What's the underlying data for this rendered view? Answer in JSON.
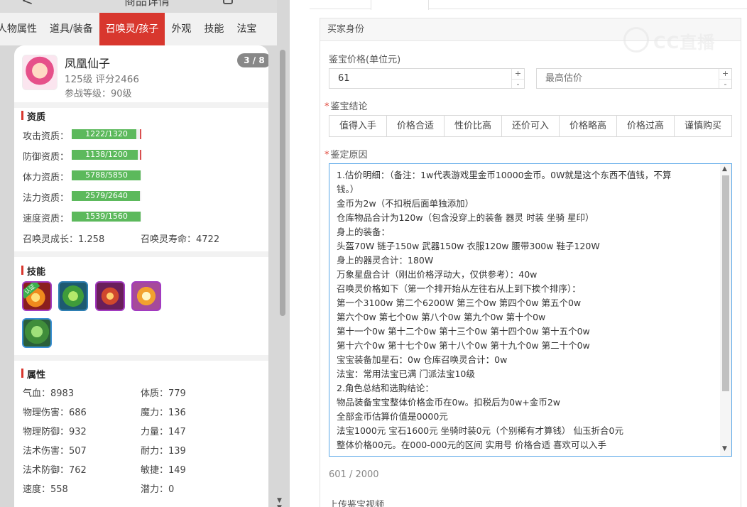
{
  "left": {
    "header": {
      "back_glyph": "<",
      "title": "商品详情"
    },
    "tabs": [
      "人物属性",
      "道具/装备",
      "召唤灵/孩子",
      "外观",
      "技能",
      "法宝"
    ],
    "active_tab_index": 2,
    "pet": {
      "name": "凤凰仙子",
      "meta": "125级 评分2466",
      "battle_level": "参战等级：90级",
      "page": "3 / 8"
    },
    "aptitude": {
      "title": "资质",
      "rows": [
        {
          "label": "攻击资质：",
          "value": "1222/1320",
          "fill": 0.926
        },
        {
          "label": "防御资质：",
          "value": "1138/1200",
          "fill": 0.948
        },
        {
          "label": "体力资质：",
          "value": "5788/5850",
          "fill": 0.989
        },
        {
          "label": "法力资质：",
          "value": "2579/2640",
          "fill": 0.977
        },
        {
          "label": "速度资质：",
          "value": "1539/1560",
          "fill": 0.987
        }
      ],
      "growth": "召唤灵成长：1.258",
      "lifespan": "召唤灵寿命：4722"
    },
    "skills": {
      "title": "技能",
      "badge": "认证"
    },
    "attributes": {
      "title": "属性",
      "items": [
        "气血：8983",
        "体质：779",
        "物理伤害：686",
        "魔力：136",
        "物理防御：932",
        "力量：147",
        "法术伤害：507",
        "耐力：139",
        "法术防御：762",
        "敏捷：149",
        "速度：558",
        "潜力：0"
      ]
    }
  },
  "right": {
    "section_title": "买家身份",
    "price_label": "鉴宝价格(单位元)",
    "price_value": "61",
    "max_price_placeholder": "最高估价",
    "conclusion_label": "鉴宝结论",
    "conclusions": [
      "值得入手",
      "价格合适",
      "性价比高",
      "还价可入",
      "价格略高",
      "价格过高",
      "谨慎购买"
    ],
    "reason_label": "鉴定原因",
    "reason_lines": [
      "1.估价明细：（备注：1w代表游戏里金币10000金币。0W就是这个东西不值钱，不算",
      "钱。）",
      "金币为2w（不扣税后面单独添加）",
      "仓库物品合计为120w（包含没穿上的装备 器灵 时装 坐骑 星印）",
      "身上的装备：",
      "头盔70W 链子150w 武器150w 衣服120w 腰带300w 鞋子120W",
      "身上的器灵合计：180W",
      "万象星盘合计（刚出价格浮动大，仅供参考）：40w",
      "召唤灵价格如下（第一个排开始从左往右从上到下挨个排序）：",
      "第一个3100w 第二个6200W 第三个0w 第四个0w 第五个0w",
      "第六个0w 第七个0w 第八个0w 第九个0w 第十个0w",
      "第十一个0w 第十二个0w 第十三个0w 第十四个0w 第十五个0w",
      "第十六个0w 第十七个0w 第十八个0w 第十九个0w 第二十个0w",
      "宝宝装备加星石：0w 仓库召唤灵合计：0w",
      "法宝：常用法宝已满 门派法宝10级",
      "2.角色总结和选购结论：",
      "物品装备宝宝整体价格金币在0w。扣税后为0w+金币2w",
      "全部金币估算价值是0000元",
      "法宝1000元 宝石1600元 坐骑时装0元（个别稀有才算钱） 仙玉折合0元",
      "整体价格00元。在000-000元的区间 实用号 价格合适 喜欢可以入手"
    ],
    "char_count": "601 / 2000",
    "upload_label": "上传鉴宝视频",
    "stepper_plus": "+",
    "stepper_minus": "-"
  },
  "watermark": "CC直播"
}
